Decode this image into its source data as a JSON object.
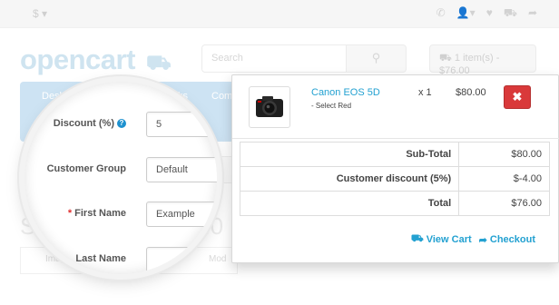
{
  "topbar": {
    "currency_symbol": "$",
    "caret": "▾"
  },
  "logo": {
    "text": "opencart"
  },
  "search": {
    "placeholder": "Search"
  },
  "header_cart": {
    "label": "1 item(s) - $76.00"
  },
  "menu": {
    "items": [
      "Desktops",
      "ks",
      "Com"
    ]
  },
  "page": {
    "heading_fragment": "Sh",
    "price_fragment": "0.0",
    "image_col": "Image",
    "model_col": "Mod"
  },
  "magnifier": {
    "fields": [
      {
        "label": "Discount (%)",
        "value": "5",
        "required": false,
        "help": true
      },
      {
        "label": "Customer Group",
        "value": "Default",
        "required": false,
        "help": false
      },
      {
        "label": "First Name",
        "value": "Example",
        "required": true,
        "help": false
      },
      {
        "label": "Last Name",
        "value": "",
        "required": false,
        "help": false
      }
    ]
  },
  "cart": {
    "product_name": "Canon EOS 5D",
    "product_option": "- Select Red",
    "quantity": "x 1",
    "price": "$80.00",
    "remove_symbol": "✖",
    "totals": [
      {
        "label": "Sub-Total",
        "value": "$80.00"
      },
      {
        "label": "Customer discount (5%)",
        "value": "$-4.00"
      },
      {
        "label": "Total",
        "value": "$76.00"
      }
    ],
    "view_cart_label": "View Cart",
    "checkout_label": "Checkout"
  },
  "colors": {
    "accent": "#23a1d1",
    "danger": "#d9393a",
    "menu_bg": "#cde3f3"
  }
}
